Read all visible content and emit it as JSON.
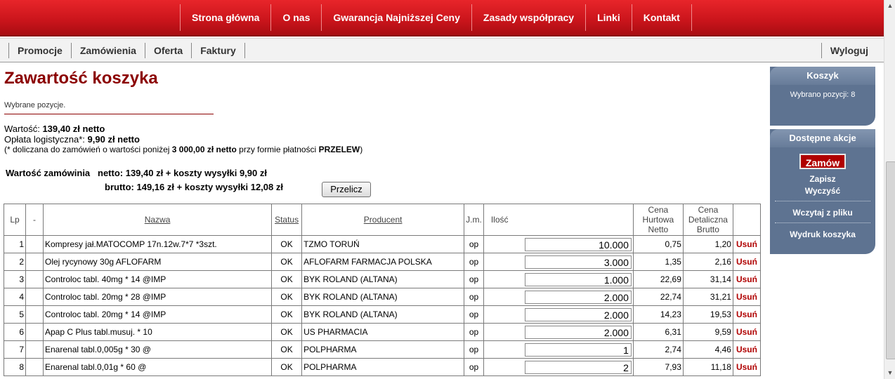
{
  "top_nav": [
    "Strona główna",
    "O nas",
    "Gwarancja Najniższej Ceny",
    "Zasady współpracy",
    "Linki",
    "Kontakt"
  ],
  "sub_nav": [
    "Promocje",
    "Zamówienia",
    "Oferta",
    "Faktury"
  ],
  "logout": "Wyloguj",
  "page": {
    "title": "Zawartość koszyka",
    "subtitle": "Wybrane pozycje.",
    "value_label": "Wartość:",
    "value": "139,40 zł netto",
    "fee_label": "Opłata logistyczna*:",
    "fee": "9,90 zł netto",
    "note_prefix": "(* doliczana do zamówień o wartości poniżej ",
    "note_amount": "3 000,00 zł netto",
    "note_mid": " przy formie płatności ",
    "note_method": "PRZELEW",
    "note_suffix": ")",
    "order_label": "Wartość zamówinia",
    "netto_line": "netto:  139,40 zł + koszty wysyłki 9,90  zł",
    "brutto_line": "brutto:  149,16 zł + koszty wysyłki 12,08  zł",
    "recalc_button": "Przelicz"
  },
  "table": {
    "headers": {
      "lp": "Lp",
      "sort": "-",
      "name": "Nazwa",
      "status": "Status",
      "producer": "Producent",
      "unit": "J.m.",
      "qty": "Ilość",
      "wholesale": "Cena Hurtowa Netto",
      "retail": "Cena Detaliczna Brutto"
    },
    "rows": [
      {
        "lp": "1",
        "name": "Kompresy jał.MATOCOMP 17n.12w.7*7 *3szt.",
        "status": "OK",
        "producer": "TZMO TORUŃ",
        "unit": "op",
        "qty": "10.000",
        "wholesale": "0,75",
        "retail": "1,20",
        "remove": "Usuń"
      },
      {
        "lp": "2",
        "name": "Olej rycynowy 30g AFLOFARM",
        "status": "OK",
        "producer": "AFLOFARM FARMACJA POLSKA",
        "unit": "op",
        "qty": "3.000",
        "wholesale": "1,35",
        "retail": "2,16",
        "remove": "Usuń"
      },
      {
        "lp": "3",
        "name": "Controloc tabl. 40mg * 14 @IMP",
        "status": "OK",
        "producer": "BYK ROLAND (ALTANA)",
        "unit": "op",
        "qty": "1.000",
        "wholesale": "22,69",
        "retail": "31,14",
        "remove": "Usuń"
      },
      {
        "lp": "4",
        "name": "Controloc tabl. 20mg * 28 @IMP",
        "status": "OK",
        "producer": "BYK ROLAND (ALTANA)",
        "unit": "op",
        "qty": "2.000",
        "wholesale": "22,74",
        "retail": "31,21",
        "remove": "Usuń"
      },
      {
        "lp": "5",
        "name": "Controloc tabl. 20mg * 14 @IMP",
        "status": "OK",
        "producer": "BYK ROLAND (ALTANA)",
        "unit": "op",
        "qty": "2.000",
        "wholesale": "14,23",
        "retail": "19,53",
        "remove": "Usuń"
      },
      {
        "lp": "6",
        "name": "Apap C Plus tabl.musuj. * 10",
        "status": "OK",
        "producer": "US PHARMACIA",
        "unit": "op",
        "qty": "2.000",
        "wholesale": "6,31",
        "retail": "9,59",
        "remove": "Usuń"
      },
      {
        "lp": "7",
        "name": "Enarenal tabl.0,005g * 30 @",
        "status": "OK",
        "producer": "POLPHARMA",
        "unit": "op",
        "qty": "1",
        "wholesale": "2,74",
        "retail": "4,46",
        "remove": "Usuń"
      },
      {
        "lp": "8",
        "name": "Enarenal tabl.0,01g * 60 @",
        "status": "OK",
        "producer": "POLPHARMA",
        "unit": "op",
        "qty": "2",
        "wholesale": "7,93",
        "retail": "11,18",
        "remove": "Usuń"
      }
    ]
  },
  "sidebar": {
    "cart_title": "Koszyk",
    "cart_info": "Wybrano pozycji: 8",
    "actions_title": "Dostępne akcje",
    "order_button": "Zamów",
    "save": "Zapisz",
    "clear": "Wyczyść",
    "load": "Wczytaj z pliku",
    "print": "Wydruk koszyka"
  },
  "colors": {
    "accent_red": "#c9141b",
    "title_red": "#8b0000",
    "sidebar_blue": "#5e7391"
  }
}
